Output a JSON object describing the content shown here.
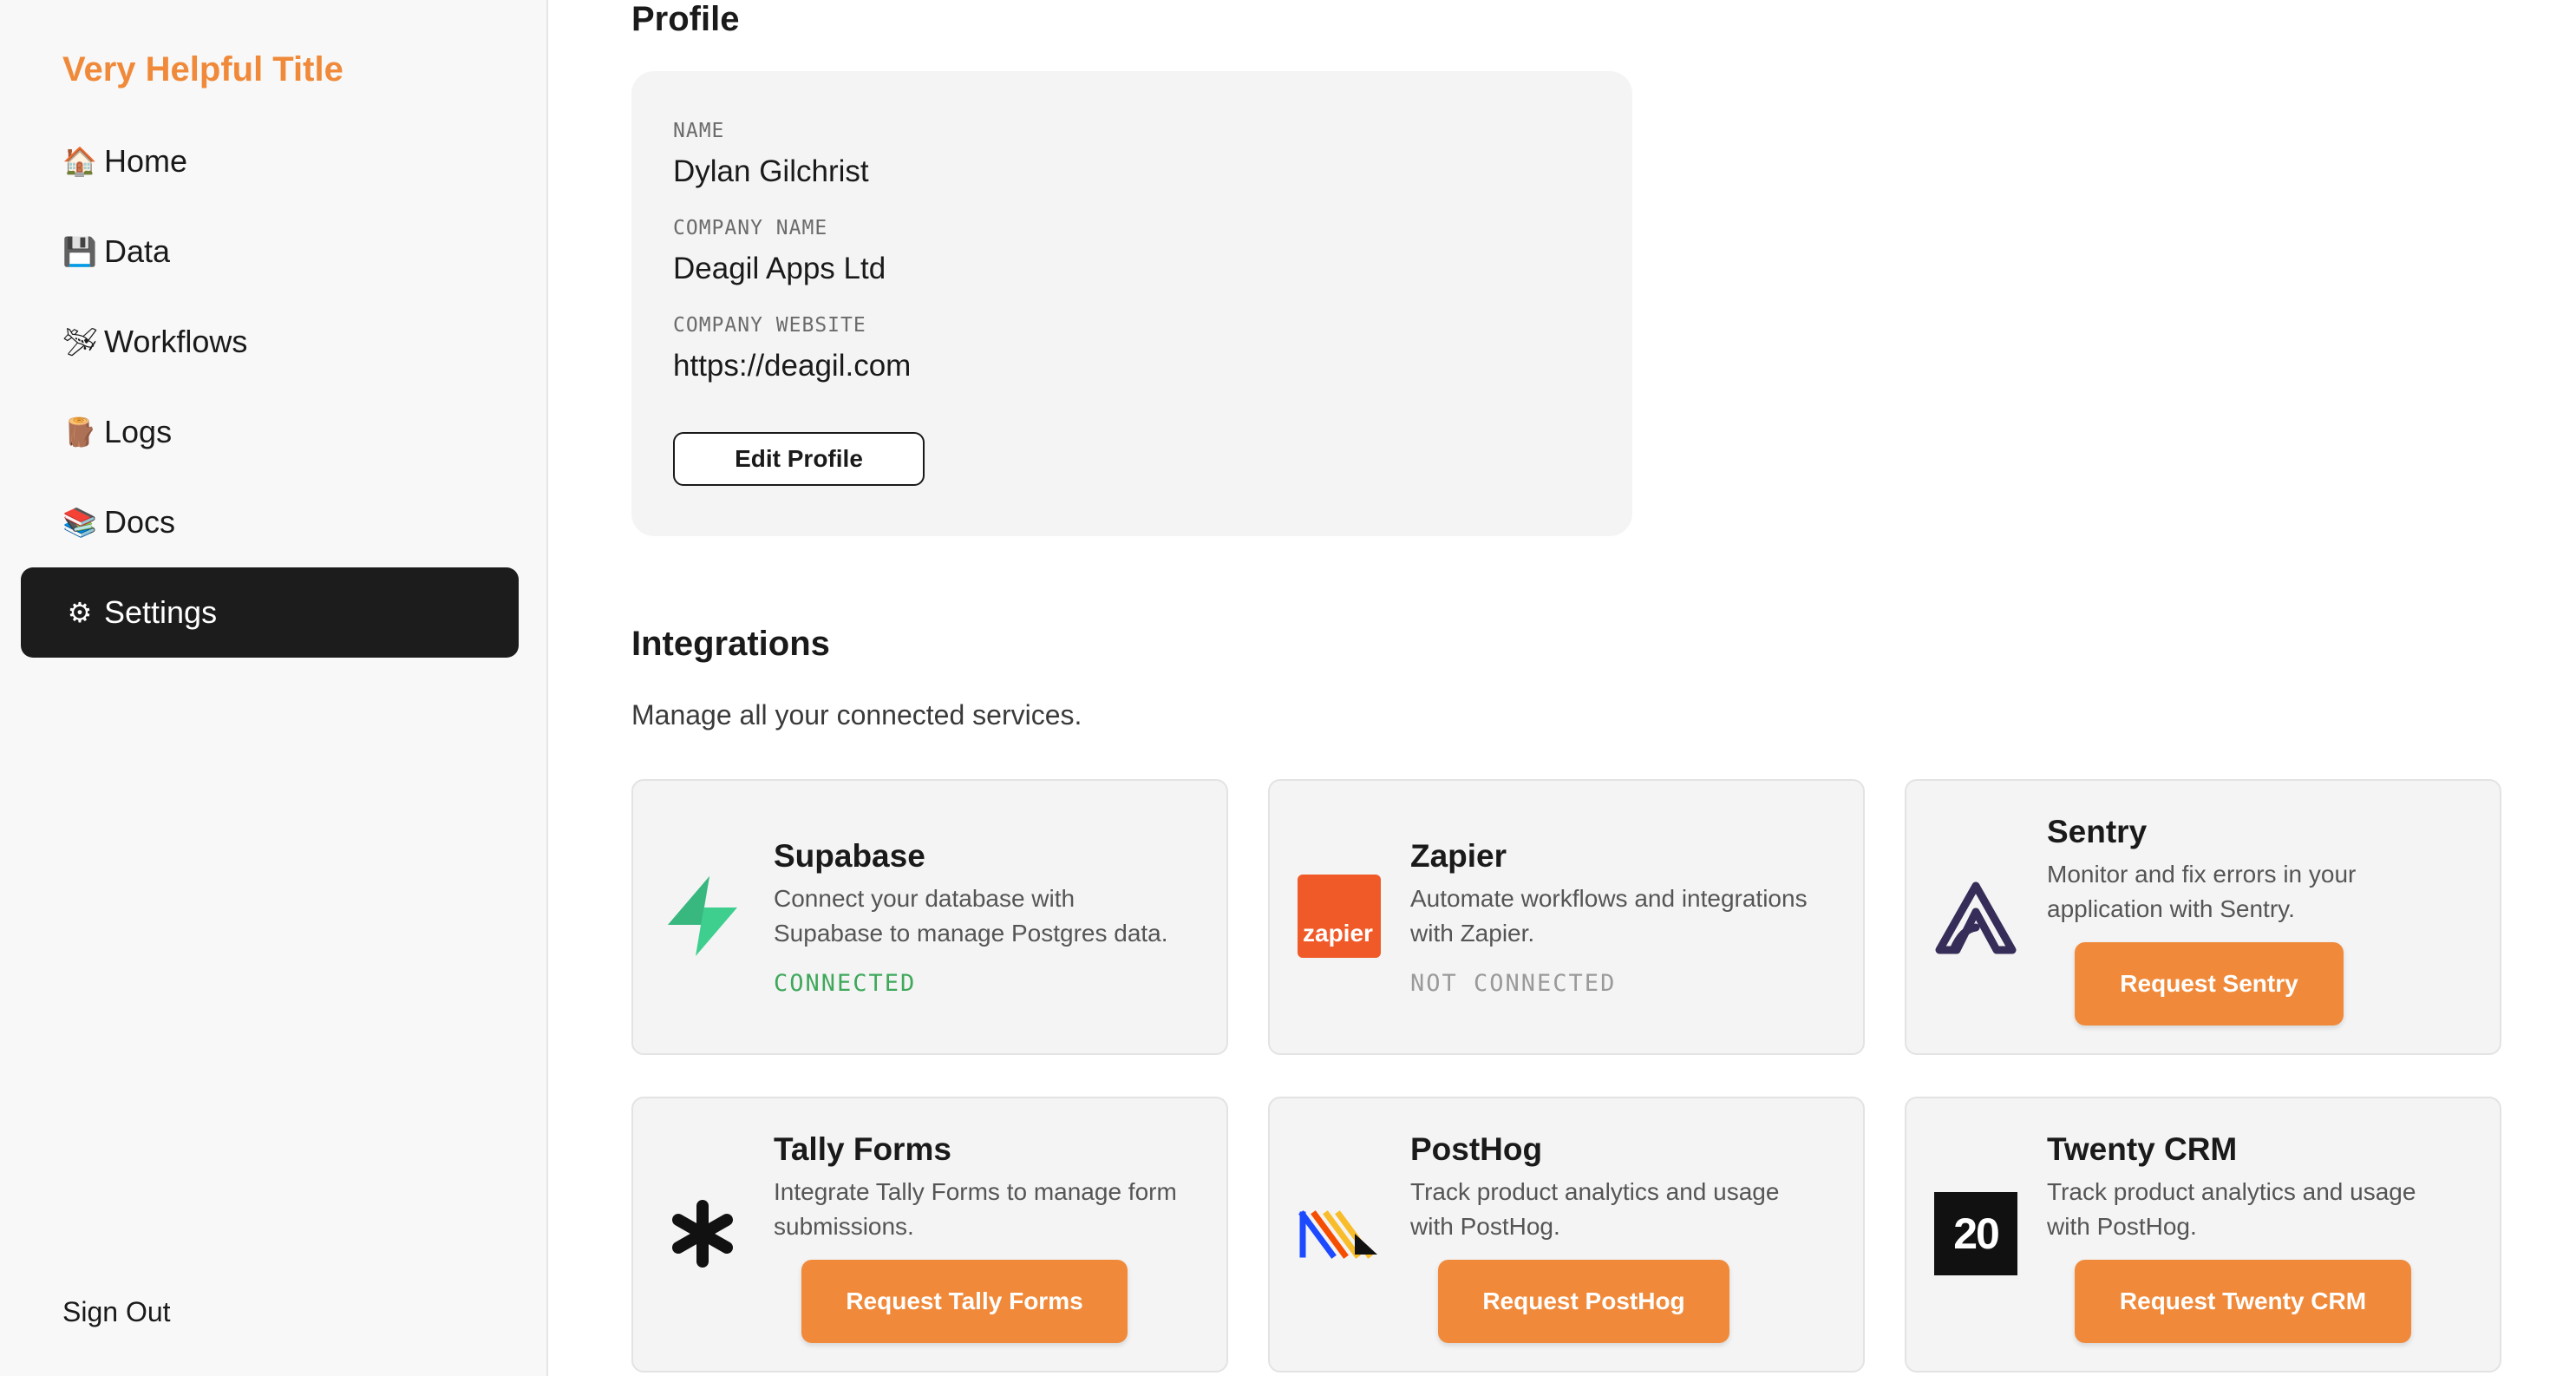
{
  "app": {
    "title": "Very Helpful Title"
  },
  "sidebar": {
    "items": [
      {
        "icon": "🏠",
        "label": "Home",
        "active": false
      },
      {
        "icon": "💾",
        "label": "Data",
        "active": false
      },
      {
        "icon": "🛩",
        "label": "Workflows",
        "active": false
      },
      {
        "icon": "🪵",
        "label": "Logs",
        "active": false
      },
      {
        "icon": "📚",
        "label": "Docs",
        "active": false
      },
      {
        "icon": "⚙",
        "label": "Settings",
        "active": true
      }
    ],
    "sign_out": "Sign Out"
  },
  "profile": {
    "heading": "Profile",
    "name_label": "NAME",
    "name": "Dylan Gilchrist",
    "company_label": "COMPANY NAME",
    "company": "Deagil Apps Ltd",
    "website_label": "COMPANY WEBSITE",
    "website": "https://deagil.com",
    "edit_button": "Edit Profile"
  },
  "integrations": {
    "heading": "Integrations",
    "subtitle": "Manage all your connected services.",
    "cards": [
      {
        "name": "Supabase",
        "icon": "supabase-bolt-icon",
        "description_lines": [
          "Connect your database with",
          "Supabase to manage Postgres data."
        ],
        "status": "CONNECTED"
      },
      {
        "name": "Zapier",
        "icon": "zapier-logo-icon",
        "logo_text": "zapier",
        "description_lines": [
          "Automate workflows and integrations",
          "with Zapier."
        ],
        "status": "NOT CONNECTED"
      },
      {
        "name": "Sentry",
        "icon": "sentry-logo-icon",
        "description_lines": [
          "Monitor and fix errors in your",
          "application with Sentry."
        ],
        "button": "Request Sentry"
      },
      {
        "name": "Tally Forms",
        "icon": "tally-asterisk-icon",
        "description_lines": [
          "Integrate Tally Forms to manage form",
          "submissions."
        ],
        "button": "Request Tally Forms"
      },
      {
        "name": "PostHog",
        "icon": "posthog-hedgehog-icon",
        "description_lines": [
          "Track product analytics and usage",
          "with PostHog."
        ],
        "button": "Request PostHog"
      },
      {
        "name": "Twenty CRM",
        "icon": "twenty-crm-logo-icon",
        "logo_text": "20",
        "description_lines": [
          "Track product analytics and usage",
          "with PostHog."
        ],
        "button": "Request Twenty CRM"
      }
    ]
  },
  "colors": {
    "accent": "#f08a3a",
    "active_nav_bg": "#1c1c1c",
    "connected": "#3fa85b",
    "not_connected": "#9a9a9a",
    "zapier": "#ff4f00",
    "supabase": "#3ecf8e",
    "sentry": "#362d59"
  }
}
